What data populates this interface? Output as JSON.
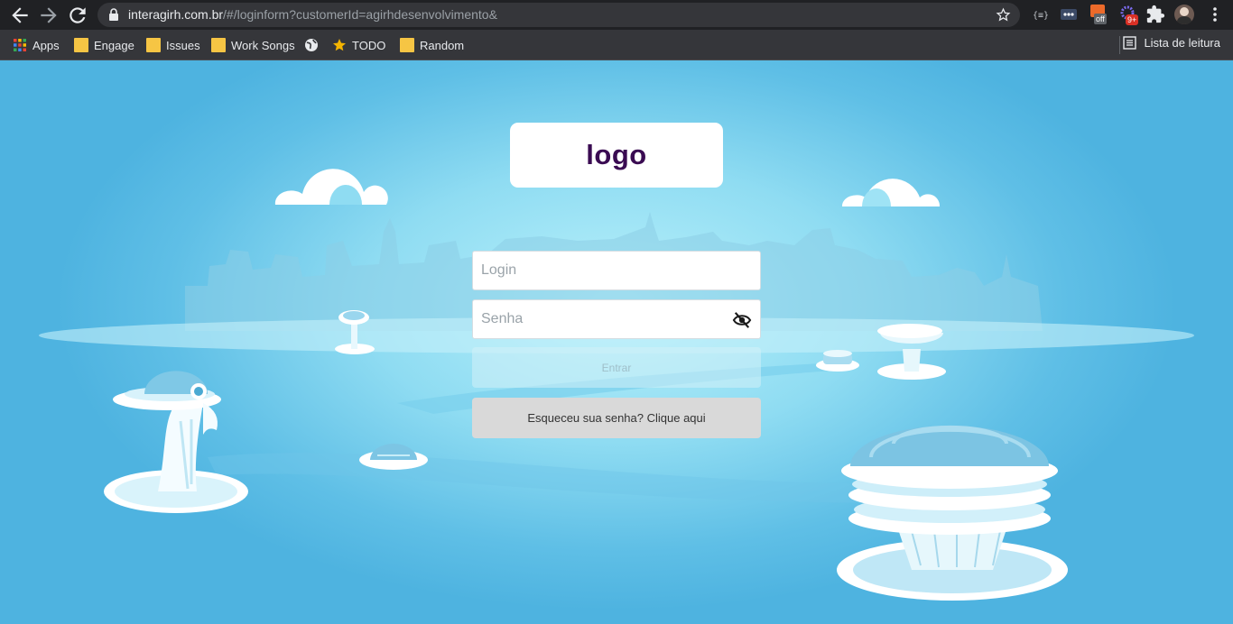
{
  "browser": {
    "url_host": "interagirh.com.br",
    "url_rest": "/#/loginform?customerId=agirhdesenvolvimento&",
    "extension_badges": {
      "off": "off",
      "count": "9+"
    }
  },
  "bookmarks": {
    "items": [
      {
        "label": "Apps",
        "icon": "apps-grid-icon"
      },
      {
        "label": "Engage",
        "icon": "folder-icon"
      },
      {
        "label": "Issues",
        "icon": "folder-icon"
      },
      {
        "label": "Work Songs",
        "icon": "folder-icon"
      },
      {
        "label": "",
        "icon": "globe-icon"
      },
      {
        "label": "TODO",
        "icon": "star-icon"
      },
      {
        "label": "Random",
        "icon": "folder-icon"
      }
    ],
    "reading_list": "Lista de leitura"
  },
  "login": {
    "logo_text": "logo",
    "login_placeholder": "Login",
    "password_placeholder": "Senha",
    "enter_label": "Entrar",
    "forgot_label": "Esqueceu sua senha? Clique aqui"
  },
  "colors": {
    "logo_text": "#3a0b52",
    "sky_light": "#b9f1fb",
    "sky_dark": "#4eb3e0"
  }
}
